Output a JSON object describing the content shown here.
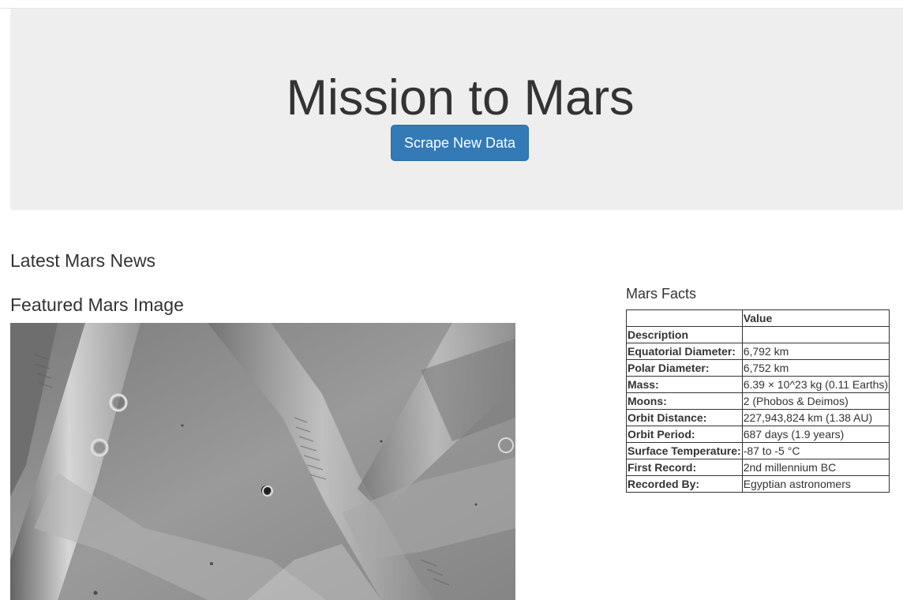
{
  "header": {
    "title": "Mission to Mars",
    "scrape_button": "Scrape New Data"
  },
  "news": {
    "heading": "Latest Mars News"
  },
  "featured_image": {
    "heading": "Featured Mars Image"
  },
  "facts": {
    "heading": "Mars Facts",
    "columns": [
      "",
      "Value"
    ],
    "rows": [
      {
        "label": "Description",
        "value": ""
      },
      {
        "label": "Equatorial Diameter:",
        "value": "6,792 km"
      },
      {
        "label": "Polar Diameter:",
        "value": "6,752 km"
      },
      {
        "label": "Mass:",
        "value": "6.39 × 10^23 kg (0.11 Earths)"
      },
      {
        "label": "Moons:",
        "value": "2 (Phobos & Deimos)"
      },
      {
        "label": "Orbit Distance:",
        "value": "227,943,824 km (1.38 AU)"
      },
      {
        "label": "Orbit Period:",
        "value": "687 days (1.9 years)"
      },
      {
        "label": "Surface Temperature:",
        "value": "-87 to -5 °C"
      },
      {
        "label": "First Record:",
        "value": "2nd millennium BC"
      },
      {
        "label": "Recorded By:",
        "value": "Egyptian astronomers"
      }
    ]
  },
  "colors": {
    "button_primary": "#337ab7",
    "jumbotron_bg": "#eeeeee",
    "text": "#333333"
  }
}
